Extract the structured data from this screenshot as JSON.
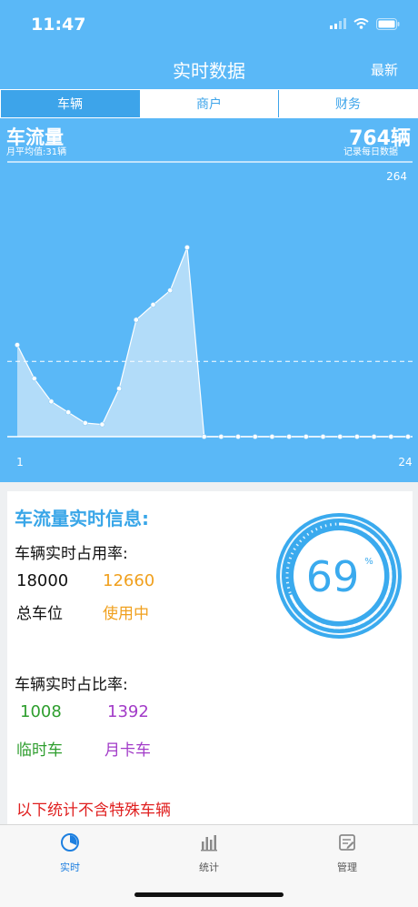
{
  "status_bar": {
    "time": "11:47"
  },
  "nav": {
    "title": "实时数据",
    "right_button": "最新"
  },
  "segments": [
    {
      "label": "车辆",
      "selected": true
    },
    {
      "label": "商户",
      "selected": false
    },
    {
      "label": "财务",
      "selected": false
    }
  ],
  "flow": {
    "title": "车流量",
    "subtitle": "月平均值:31辆",
    "total": "764辆",
    "note": "记录每日数据"
  },
  "chart_data": {
    "type": "area",
    "x": [
      1,
      2,
      3,
      4,
      5,
      6,
      7,
      8,
      9,
      10,
      11,
      12,
      13,
      14,
      15,
      16,
      17,
      18,
      19,
      20,
      21,
      22,
      23,
      24
    ],
    "values": [
      128,
      81,
      49,
      34,
      19,
      17,
      67,
      163,
      184,
      204,
      264,
      0,
      0,
      0,
      0,
      0,
      0,
      0,
      0,
      0,
      0,
      0,
      0,
      0
    ],
    "ylim": [
      0,
      264
    ],
    "y_tick_label": "264",
    "x_tick_labels": [
      "1",
      "24"
    ],
    "reference_line": 105,
    "grid": false,
    "colors": {
      "fill": "#c2e2f9",
      "line": "#ffffff",
      "background": "#5ab8f7"
    }
  },
  "info": {
    "title": "车流量实时信息:",
    "occupancy_label": "车辆实时占用率:",
    "total_spaces": "18000",
    "in_use": "12660",
    "total_spaces_label": "总车位",
    "in_use_label": "使用中",
    "ratio_label": "车辆实时占比率:",
    "temp_count": "1008",
    "monthly_count": "1392",
    "temp_label": "临时车",
    "monthly_label": "月卡车",
    "note": "以下统计不含特殊车辆",
    "gauge_value": "69",
    "gauge_unit": "%",
    "gauge_fraction": 0.69
  },
  "colors": {
    "accent": "#3da4ea",
    "header_bg": "#5ab8f7",
    "orange": "#f0a01e",
    "green": "#2e9e2e",
    "purple": "#a23bc8",
    "red": "#e02020"
  },
  "tabs": [
    {
      "label": "实时",
      "icon": "pie-clock-icon",
      "active": true
    },
    {
      "label": "统计",
      "icon": "bar-chart-icon",
      "active": false
    },
    {
      "label": "管理",
      "icon": "edit-note-icon",
      "active": false
    }
  ]
}
